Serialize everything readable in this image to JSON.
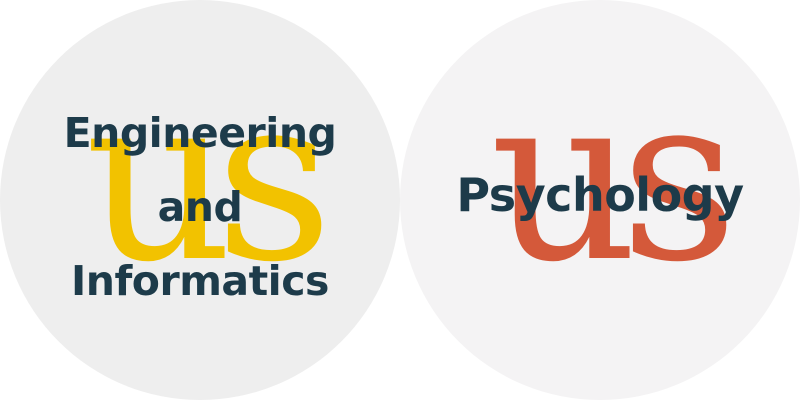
{
  "colors": {
    "ink": "#1d3b4a",
    "engineering_accent": "#f2c200",
    "psychology_accent": "#d4593a",
    "badge_bg_left": "#eeeeee",
    "badge_bg_right": "#f4f3f4"
  },
  "badges": [
    {
      "monogram": "us",
      "lines": [
        "Engineering",
        "and",
        "Informatics"
      ]
    },
    {
      "monogram": "us",
      "lines": [
        "Psychology"
      ]
    }
  ]
}
